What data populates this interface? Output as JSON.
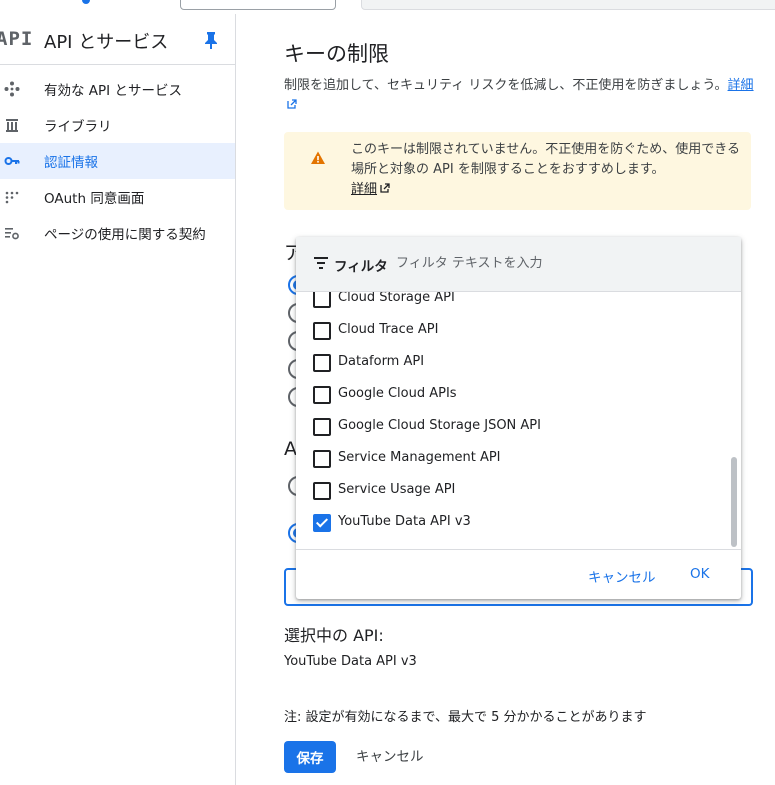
{
  "sidebar": {
    "logo": "API",
    "title": "API とサービス",
    "items": [
      {
        "label": "有効な API とサービス",
        "icon": "api-diamond-icon"
      },
      {
        "label": "ライブラリ",
        "icon": "library-icon"
      },
      {
        "label": "認証情報",
        "icon": "key-icon",
        "active": true
      },
      {
        "label": "OAuth 同意画面",
        "icon": "oauth-consent-icon"
      },
      {
        "label": "ページの使用に関する契約",
        "icon": "settings-list-icon"
      }
    ]
  },
  "main": {
    "heading": "キーの制限",
    "description": "制限を追加して、セキュリティ リスクを低減し、不正使用を防ぎましょう。",
    "details_link": "詳細",
    "warning": {
      "text": "このキーは制限されていません。不正使用を防ぐため、使用できる場所と対象の API を制限することをおすすめします。",
      "link": "詳細",
      "color": "#fef7e0"
    },
    "app_section_partial": "ア",
    "api_section_partial": "A",
    "selected_title": "選択中の API:",
    "selected_value": "YouTube Data API v3",
    "note": "注: 設定が有効になるまで、最大で 5 分かかることがあります",
    "save_label": "保存",
    "cancel_label": "キャンセル"
  },
  "dropdown": {
    "filter_label": "フィルタ",
    "filter_placeholder": "フィルタ テキストを入力",
    "options": [
      {
        "label": "Cloud Storage API",
        "checked": false
      },
      {
        "label": "Cloud Trace API",
        "checked": false
      },
      {
        "label": "Dataform API",
        "checked": false
      },
      {
        "label": "Google Cloud APIs",
        "checked": false
      },
      {
        "label": "Google Cloud Storage JSON API",
        "checked": false
      },
      {
        "label": "Service Management API",
        "checked": false
      },
      {
        "label": "Service Usage API",
        "checked": false
      },
      {
        "label": "YouTube Data API v3",
        "checked": true
      }
    ],
    "cancel_label": "キャンセル",
    "ok_label": "OK"
  },
  "colors": {
    "accent": "#1a73e8",
    "active_bg": "#e8f0fe",
    "warning_icon": "#e37400"
  }
}
